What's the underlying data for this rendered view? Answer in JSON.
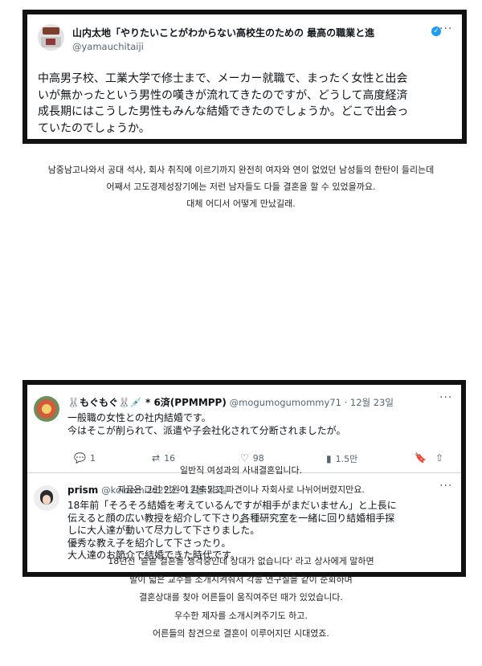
{
  "tweet1": {
    "author": "山内太地「やりたいことがわからない高校生のための 最高の職業と進",
    "handle": "@yamauchitaiji",
    "more": "···",
    "lines": [
      "中高男子校、工業大学で修士まで、メーカー就職で、まったく女性と出会",
      "いが無かったという男性の嘆きが流れてきたのですが、どうして高度経済",
      "成長期にはこうした男性もみんな結婚できたのでしょうか。どこで出会っ",
      "ていたのでしょうか。"
    ]
  },
  "caption1": [
    "남중남고나와서 공대 석사, 회사 취직에 이르기까지 완전히 여자와 연이 없었던 남성들의 한탄이 들리는데",
    "어째서 고도경제성장기에는 저런 남자들도 다들 결혼을 할 수 있었을까요.",
    "대체 어디서 어떻게 만났길래."
  ],
  "reply1": {
    "author": "🐰もぐもぐ🐰💉 * 6済(PPMMPP)",
    "handle": "@mogumogumommy71 · 12월 23일",
    "more": "···",
    "lines": [
      "一般職の女性との社内結婚です。",
      "今はそこが削られて、派遣や子会社化されて分断されましたが。"
    ],
    "actions": {
      "reply_icon": "reply-icon",
      "reply": "1",
      "retweet_icon": "retweet-icon",
      "retweet": "16",
      "like_icon": "heart-icon",
      "like": "98",
      "views_icon": "views-icon",
      "views": "1.5만",
      "bookmark_icon": "bookmark-icon",
      "share_icon": "share-icon"
    }
  },
  "reply2": {
    "author": "prism",
    "handle": "@koidemizu222 · 12월 23일",
    "more": "···",
    "lines": [
      "18年前「そろそろ結婚を考えているんですが相手がまだいません」と上長に",
      "伝えると顔の広い教授を紹介して下さり各種研究室を一緒に回り結婚相手探",
      "しに大人達が動いて尽力して下さりました。",
      "優秀な教え子を紹介して下さったり。",
      "大人達のお節介で結婚できた時代です。"
    ]
  },
  "caption2": [
    "일반직 여성과의 사내결혼입니다.",
    "지금은 그런 인원이 감축되고 파견이나 자회사로 나뉘어버렸지만요."
  ],
  "divider": "*",
  "caption3": [
    "18년전 '슬슬 결혼을 생각중인데 상대가 없습니다' 라고 상사에게 말하면",
    "발이 넓은 교수를 소개시켜줘서 각종 연구실을 같이 순회하며",
    "결혼상대를 찾아 어른들이 움직여주던 때가 있었습니다.",
    "우수한 제자를 소개시켜주기도 하고.",
    "어른들의 참견으로 결혼이 이루어지던 시대였죠."
  ]
}
